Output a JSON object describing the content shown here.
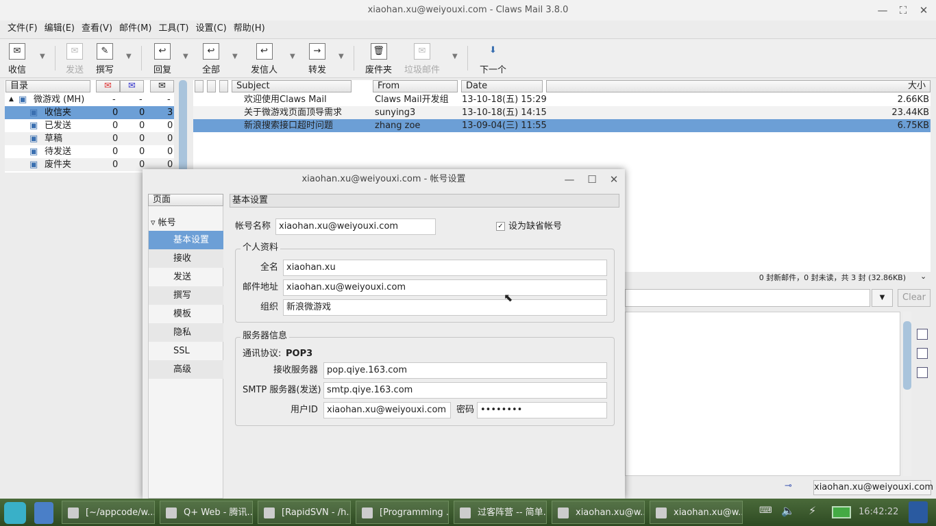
{
  "window": {
    "title": "xiaohan.xu@weiyouxi.com - Claws Mail 3.8.0"
  },
  "menu": [
    "文件(F)",
    "编辑(E)",
    "查看(V)",
    "邮件(M)",
    "工具(T)",
    "设置(C)",
    "帮助(H)"
  ],
  "toolbar": [
    {
      "label": "收信",
      "icon": "get-mail-icon",
      "enabled": true
    },
    {
      "label": "发送",
      "icon": "send-icon",
      "enabled": false
    },
    {
      "label": "撰写",
      "icon": "compose-icon",
      "enabled": true
    },
    {
      "label": "回复",
      "icon": "reply-icon",
      "enabled": true
    },
    {
      "label": "全部",
      "icon": "reply-all-icon",
      "enabled": true
    },
    {
      "label": "发信人",
      "icon": "reply-sender-icon",
      "enabled": true
    },
    {
      "label": "转发",
      "icon": "forward-icon",
      "enabled": true
    },
    {
      "label": "废件夹",
      "icon": "trash-icon",
      "enabled": true
    },
    {
      "label": "垃圾邮件",
      "icon": "spam-icon",
      "enabled": false
    },
    {
      "label": "下一个",
      "icon": "next-icon",
      "enabled": true
    }
  ],
  "folders": {
    "header": "目录",
    "rows": [
      {
        "name": "微游戏 (MH)",
        "new": "-",
        "unread": "-",
        "total": "-"
      },
      {
        "name": "收信夹",
        "new": "0",
        "unread": "0",
        "total": "3"
      },
      {
        "name": "已发送",
        "new": "0",
        "unread": "0",
        "total": "0"
      },
      {
        "name": "草稿",
        "new": "0",
        "unread": "0",
        "total": "0"
      },
      {
        "name": "待发送",
        "new": "0",
        "unread": "0",
        "total": "0"
      },
      {
        "name": "废件夹",
        "new": "0",
        "unread": "0",
        "total": "0"
      }
    ]
  },
  "messages": {
    "headers": {
      "subject": "Subject",
      "from": "From",
      "date": "Date",
      "size": "大小"
    },
    "rows": [
      {
        "subject": "欢迎使用Claws Mail",
        "from": "Claws Mail开发组",
        "date": "13-10-18(五) 15:29",
        "size": "2.66KB"
      },
      {
        "subject": "关于微游戏页面顶导需求",
        "from": "sunying3",
        "date": "13-10-18(五) 14:15",
        "size": "23.44KB"
      },
      {
        "subject": "新浪搜索接口超时问题",
        "from": "zhang zoe",
        "date": "13-09-04(三) 11:55",
        "size": "6.75KB"
      }
    ]
  },
  "status_summary": "0 封新邮件，0 封未读，共 3 封 (32.86KB)",
  "search": {
    "clear": "Clear"
  },
  "statusbar": {
    "account": "xiaohan.xu@weiyouxi.com"
  },
  "dialog": {
    "title": "xiaohan.xu@weiyouxi.com - 帐号设置",
    "pages_header": "页面",
    "account_node": "帐号",
    "pages": [
      "基本设置",
      "接收",
      "发送",
      "撰写",
      "模板",
      "隐私",
      "SSL",
      "高级"
    ],
    "section_title": "基本设置",
    "account_name_label": "帐号名称",
    "account_name": "xiaohan.xu@weiyouxi.com",
    "default_label": "设为缺省帐号",
    "default_checked": true,
    "personal_title": "个人资料",
    "fullname_label": "全名",
    "fullname": "xiaohan.xu",
    "email_label": "邮件地址",
    "email": "xiaohan.xu@weiyouxi.com",
    "org_label": "组织",
    "org": "新浪微游戏",
    "server_title": "服务器信息",
    "protocol_label": "通讯协议:",
    "protocol": "POP3",
    "recv_label": "接收服务器",
    "recv": "pop.qiye.163.com",
    "smtp_label": "SMTP 服务器(发送)",
    "smtp": "smtp.qiye.163.com",
    "uid_label": "用户ID",
    "uid": "xiaohan.xu@weiyouxi.com",
    "pwd_label": "密码",
    "pwd": "••••••••"
  },
  "taskbar": {
    "tasks": [
      "[~/appcode/w...",
      "Q+ Web - 腾讯...",
      "[RapidSVN - /h...",
      "[Programming ...",
      "过客阵营 -- 简单...",
      "xiaohan.xu@w...",
      "xiaohan.xu@w..."
    ],
    "clock": "16:42:22"
  }
}
